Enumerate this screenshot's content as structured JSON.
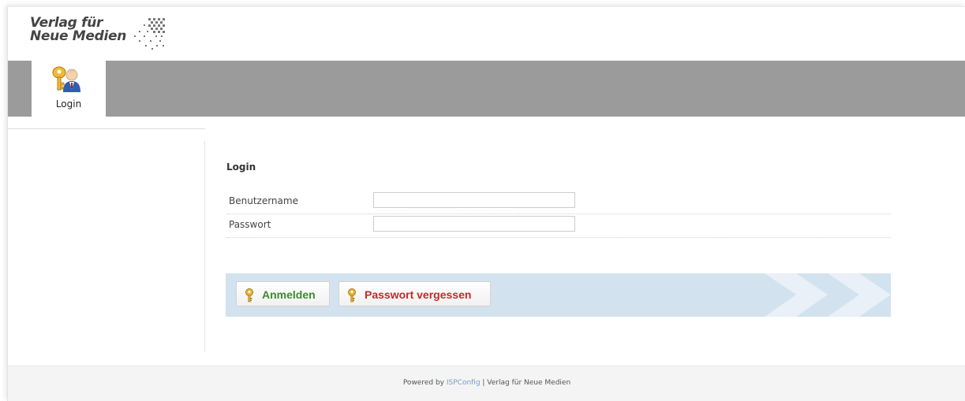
{
  "header": {
    "logo_line1": "Verlag für",
    "logo_line2": "Neue Medien",
    "logo_icon": "dot-pattern-icon"
  },
  "nav": {
    "tabs": [
      {
        "label": "Login",
        "icon": "login-users-key-icon",
        "active": true
      }
    ]
  },
  "form": {
    "title": "Login",
    "fields": [
      {
        "label": "Benutzername",
        "value": "",
        "placeholder": ""
      },
      {
        "label": "Passwort",
        "value": "",
        "placeholder": ""
      }
    ]
  },
  "actions": {
    "login_label": "Anmelden",
    "forgot_label": "Passwort vergessen",
    "icon": "key-icon"
  },
  "footer": {
    "prefix": "Powered by ",
    "link": "ISPConfig",
    "separator": " | ",
    "suffix": "Verlag für Neue Medien"
  },
  "colors": {
    "navbar": "#9b9b9b",
    "action_bar": "#d2e2ef",
    "login_text": "#3d8a2e",
    "forgot_text": "#c6282a",
    "footer_link": "#7a9cc6"
  }
}
